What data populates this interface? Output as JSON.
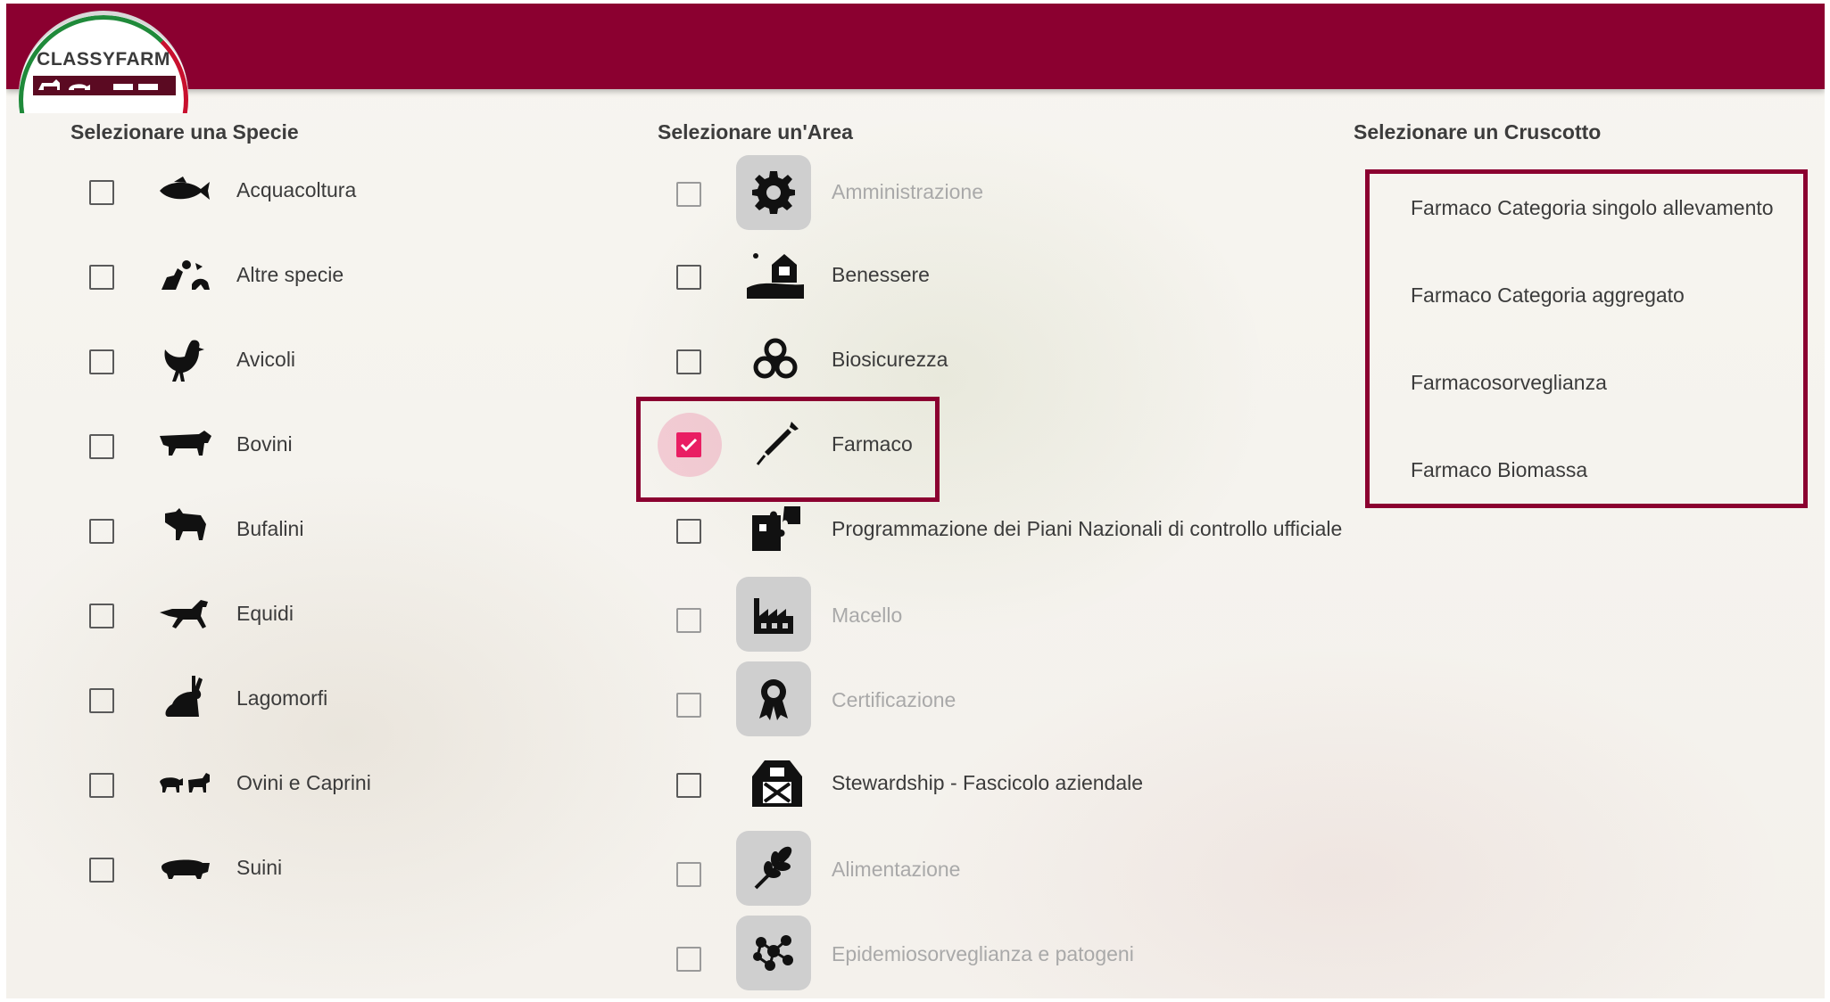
{
  "app": {
    "logo_text": "CLASSYFARM"
  },
  "colors": {
    "brand": "#8b0030",
    "checked": "#e91e63",
    "disabled_text": "#a9a9a9"
  },
  "species": {
    "title": "Selezionare una Specie",
    "items": [
      {
        "label": "Acquacoltura",
        "icon": "fish-icon",
        "checked": false
      },
      {
        "label": "Altre specie",
        "icon": "other-animals-icon",
        "checked": false
      },
      {
        "label": "Avicoli",
        "icon": "chicken-icon",
        "checked": false
      },
      {
        "label": "Bovini",
        "icon": "cow-icon",
        "checked": false
      },
      {
        "label": "Bufalini",
        "icon": "buffalo-icon",
        "checked": false
      },
      {
        "label": "Equidi",
        "icon": "horse-icon",
        "checked": false
      },
      {
        "label": "Lagomorfi",
        "icon": "rabbit-icon",
        "checked": false
      },
      {
        "label": "Ovini e Caprini",
        "icon": "sheep-goat-icon",
        "checked": false
      },
      {
        "label": "Suini",
        "icon": "pig-icon",
        "checked": false
      }
    ]
  },
  "areas": {
    "title": "Selezionare un'Area",
    "items": [
      {
        "label": "Amministrazione",
        "icon": "gear-icon",
        "checked": false,
        "disabled": true
      },
      {
        "label": "Benessere",
        "icon": "farm-sun-icon",
        "checked": false,
        "disabled": false
      },
      {
        "label": "Biosicurezza",
        "icon": "biohazard-icon",
        "checked": false,
        "disabled": false
      },
      {
        "label": "Farmaco",
        "icon": "syringe-icon",
        "checked": true,
        "disabled": false
      },
      {
        "label": "Programmazione dei Piani Nazionali di controllo ufficiale",
        "icon": "puzzle-icon",
        "checked": false,
        "disabled": false
      },
      {
        "label": "Macello",
        "icon": "factory-icon",
        "checked": false,
        "disabled": true
      },
      {
        "label": "Certificazione",
        "icon": "award-icon",
        "checked": false,
        "disabled": true
      },
      {
        "label": "Stewardship - Fascicolo aziendale",
        "icon": "barn-icon",
        "checked": false,
        "disabled": false
      },
      {
        "label": "Alimentazione",
        "icon": "wheat-icon",
        "checked": false,
        "disabled": true
      },
      {
        "label": "Epidemiosorveglianza e patogeni",
        "icon": "molecule-icon",
        "checked": false,
        "disabled": true
      }
    ]
  },
  "dashboards": {
    "title": "Selezionare un Cruscotto",
    "items": [
      "Farmaco Categoria singolo allevamento",
      "Farmaco Categoria aggregato",
      "Farmacosorveglianza",
      "Farmaco Biomassa"
    ]
  }
}
